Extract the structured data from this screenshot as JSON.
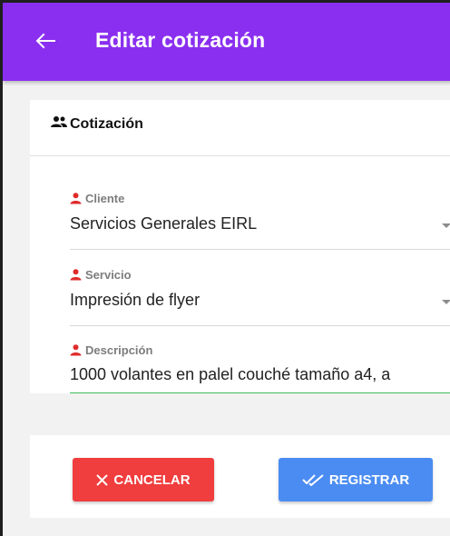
{
  "header": {
    "title": "Editar cotización",
    "back_icon": "arrow-left-icon",
    "color": "#8a2ff0"
  },
  "card": {
    "title": "Cotización",
    "title_icon": "people-icon"
  },
  "fields": {
    "cliente": {
      "label": "Cliente",
      "value": "Servicios Generales EIRL",
      "icon": "person-icon"
    },
    "servicio": {
      "label": "Servicio",
      "value": "Impresión de flyer",
      "icon": "person-icon"
    },
    "descripcion": {
      "label": "Descripción",
      "value": "1000 volantes en palel couché tamaño a4, a",
      "icon": "person-icon"
    }
  },
  "actions": {
    "cancel_label": "CANCELAR",
    "cancel_icon": "close-icon",
    "cancel_color": "#f03d3d",
    "register_label": "REGISTRAR",
    "register_icon": "double-check-icon",
    "register_color": "#4a8cf2"
  },
  "colors": {
    "label_icon": "#e02b2b",
    "focus_underline": "#3cbf5a"
  }
}
